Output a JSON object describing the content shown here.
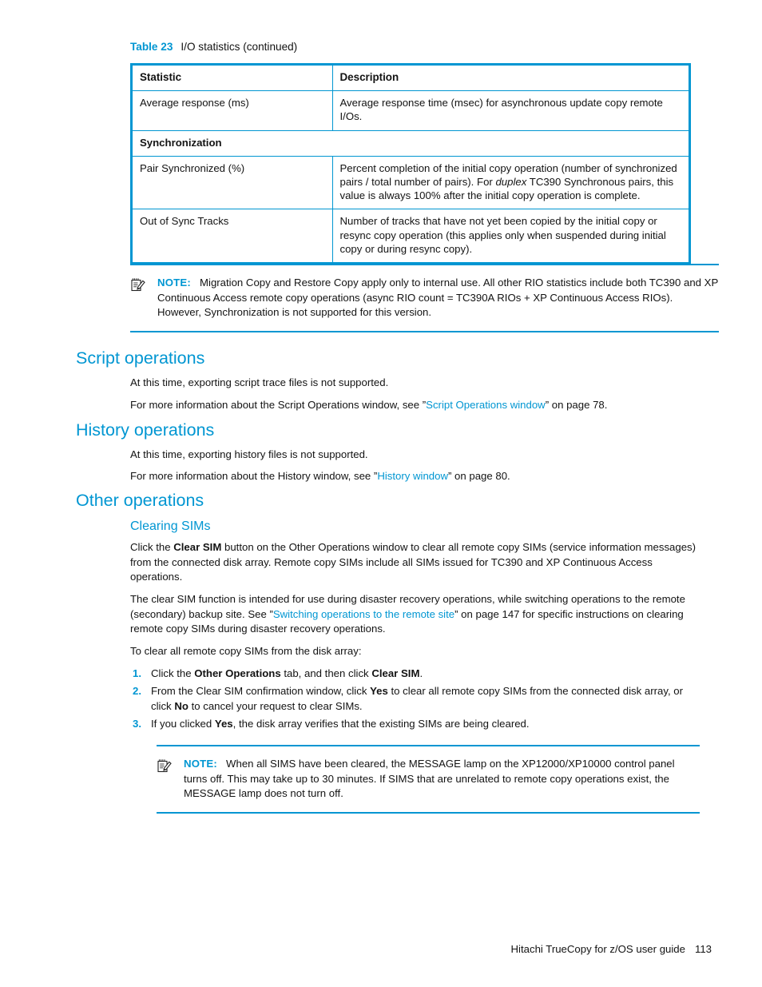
{
  "table": {
    "caption_label": "Table 23",
    "caption_title": "I/O statistics (continued)",
    "headers": [
      "Statistic",
      "Description"
    ],
    "section_row": "Synchronization",
    "rows": [
      {
        "statistic": "Average response (ms)",
        "description": "Average response time (msec) for asynchronous update copy remote I/Os."
      },
      {
        "statistic": "Pair Synchronized (%)",
        "description_part1": "Percent completion of the initial copy operation (number of synchronized pairs / total number of pairs). For ",
        "description_italic": "duplex",
        "description_part2": " TC390 Synchronous pairs, this value is always 100% after the initial copy operation is complete."
      },
      {
        "statistic": "Out of Sync Tracks",
        "description": "Number of tracks that have not yet been copied by the initial copy or resync copy operation (this applies only when suspended during initial copy or during resync copy)."
      }
    ]
  },
  "note_top": {
    "label": "NOTE:",
    "text": "Migration Copy and Restore Copy apply only to internal use. All other RIO statistics include both TC390 and XP Continuous Access remote copy operations (async RIO count = TC390A RIOs + XP Continuous Access RIOs). However, Synchronization is not supported for this version.",
    "icon": "note-pad-pencil-icon"
  },
  "sections": {
    "script_operations": {
      "heading": "Script operations",
      "para1": "At this time, exporting script trace files is not supported.",
      "para2_before": "For more information about the Script Operations window, see ”",
      "para2_link": "Script Operations window",
      "para2_after": "” on page 78."
    },
    "history_operations": {
      "heading": "History operations",
      "para1": "At this time, exporting history files is not supported.",
      "para2_before": "For more information about the History window, see ”",
      "para2_link": "History window",
      "para2_after": "” on page 80."
    },
    "other_operations": {
      "heading": "Other operations",
      "subheading": "Clearing SIMs",
      "para1_a": "Click the ",
      "para1_b": "Clear SIM",
      "para1_c": " button on the Other Operations window to clear all remote copy SIMs (service information messages) from the connected disk array. Remote copy SIMs include all SIMs issued for TC390 and XP Continuous Access operations.",
      "para2_before": "The clear SIM function is intended for use during disaster recovery operations, while switching operations to the remote (secondary) backup site. See ”",
      "para2_link": "Switching operations to the remote site",
      "para2_after": "” on page 147 for specific instructions on clearing remote copy SIMs during disaster recovery operations.",
      "intro": "To clear all remote copy SIMs from the disk array:",
      "steps": [
        {
          "num": "1.",
          "a": "Click the ",
          "b1": "Other Operations",
          "c": " tab, and then click ",
          "b2": "Clear SIM",
          "d": "."
        },
        {
          "num": "2.",
          "a": "From the Clear SIM confirmation window, click ",
          "b1": "Yes",
          "c": " to clear all remote copy SIMs from the connected disk array, or click ",
          "b2": "No",
          "d": " to cancel your request to clear SIMs."
        },
        {
          "num": "3.",
          "a": "If you clicked ",
          "b1": "Yes",
          "c": ", the disk array verifies that the existing SIMs are being cleared.",
          "b2": "",
          "d": ""
        }
      ]
    }
  },
  "note_bottom": {
    "label": "NOTE:",
    "text": "When all SIMS have been cleared, the MESSAGE lamp on the XP12000/XP10000 control panel turns off. This may take up to 30 minutes. If SIMS that are unrelated to remote copy operations exist, the MESSAGE lamp does not turn off.",
    "icon": "note-pad-pencil-icon"
  },
  "footer": {
    "title": "Hitachi TrueCopy for z/OS user guide",
    "page": "113"
  },
  "colors": {
    "accent": "#0096D2",
    "text": "#131313"
  }
}
